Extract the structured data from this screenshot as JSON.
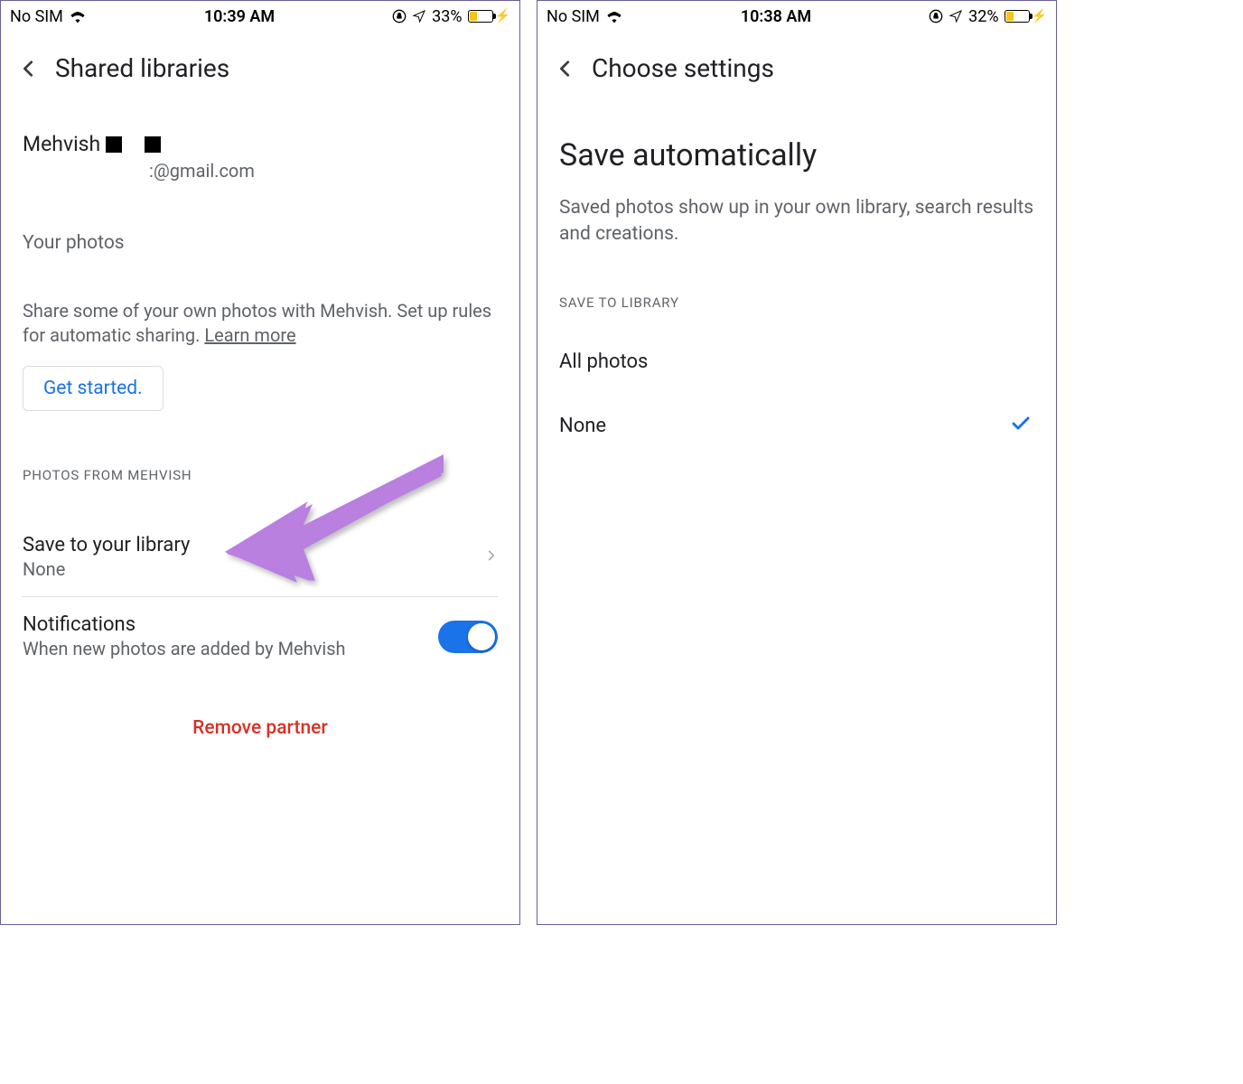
{
  "left": {
    "status": {
      "carrier": "No SIM",
      "time": "10:39 AM",
      "battery": "33%"
    },
    "header": "Shared libraries",
    "partner_name": "Mehvish",
    "partner_email": ":@gmail.com",
    "your_photos": "Your photos",
    "share_desc": "Share some of your own photos with Mehvish. Set up rules for automatic sharing. ",
    "learn_more": "Learn more",
    "get_started": "Get started.",
    "section_label": "PHOTOS FROM MEHVISH",
    "save_row": {
      "title": "Save to your library",
      "value": "None"
    },
    "notif_row": {
      "title": "Notifications",
      "sub": "When new photos are added by Mehvish"
    },
    "remove": "Remove partner"
  },
  "right": {
    "status": {
      "carrier": "No SIM",
      "time": "10:38 AM",
      "battery": "32%"
    },
    "header": "Choose settings",
    "title": "Save automatically",
    "desc": "Saved photos show up in your own library, search results and creations.",
    "section_label": "SAVE TO LIBRARY",
    "options": [
      {
        "label": "All photos",
        "selected": false
      },
      {
        "label": "None",
        "selected": true
      }
    ]
  }
}
